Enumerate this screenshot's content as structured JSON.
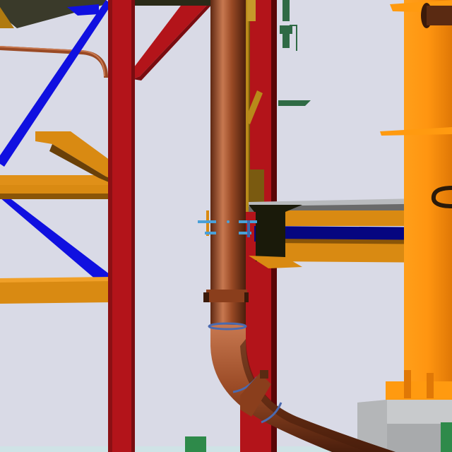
{
  "scene": {
    "kind": "3D plant piping model render",
    "colors": {
      "background": "#d9dae6",
      "steel_red": "#b3141a",
      "steel_red_dark": "#7a0c10",
      "brace_blue": "#1010e0",
      "beam_orange": "#d98a12",
      "beam_orange_dark": "#8a5508",
      "pipe_copper": "#9a4a25",
      "pipe_highlight": "#c77850",
      "pipe_shadow": "#5e2812",
      "vessel_orange": "#ff9a10",
      "vessel_shadow": "#d06a00",
      "conduit_gold": "#b88a1a",
      "valve_green": "#2f6a45",
      "support_clamp_blue": "#4aa0d8",
      "concrete_grey": "#b8babd",
      "navy_beam": "#060680"
    }
  }
}
